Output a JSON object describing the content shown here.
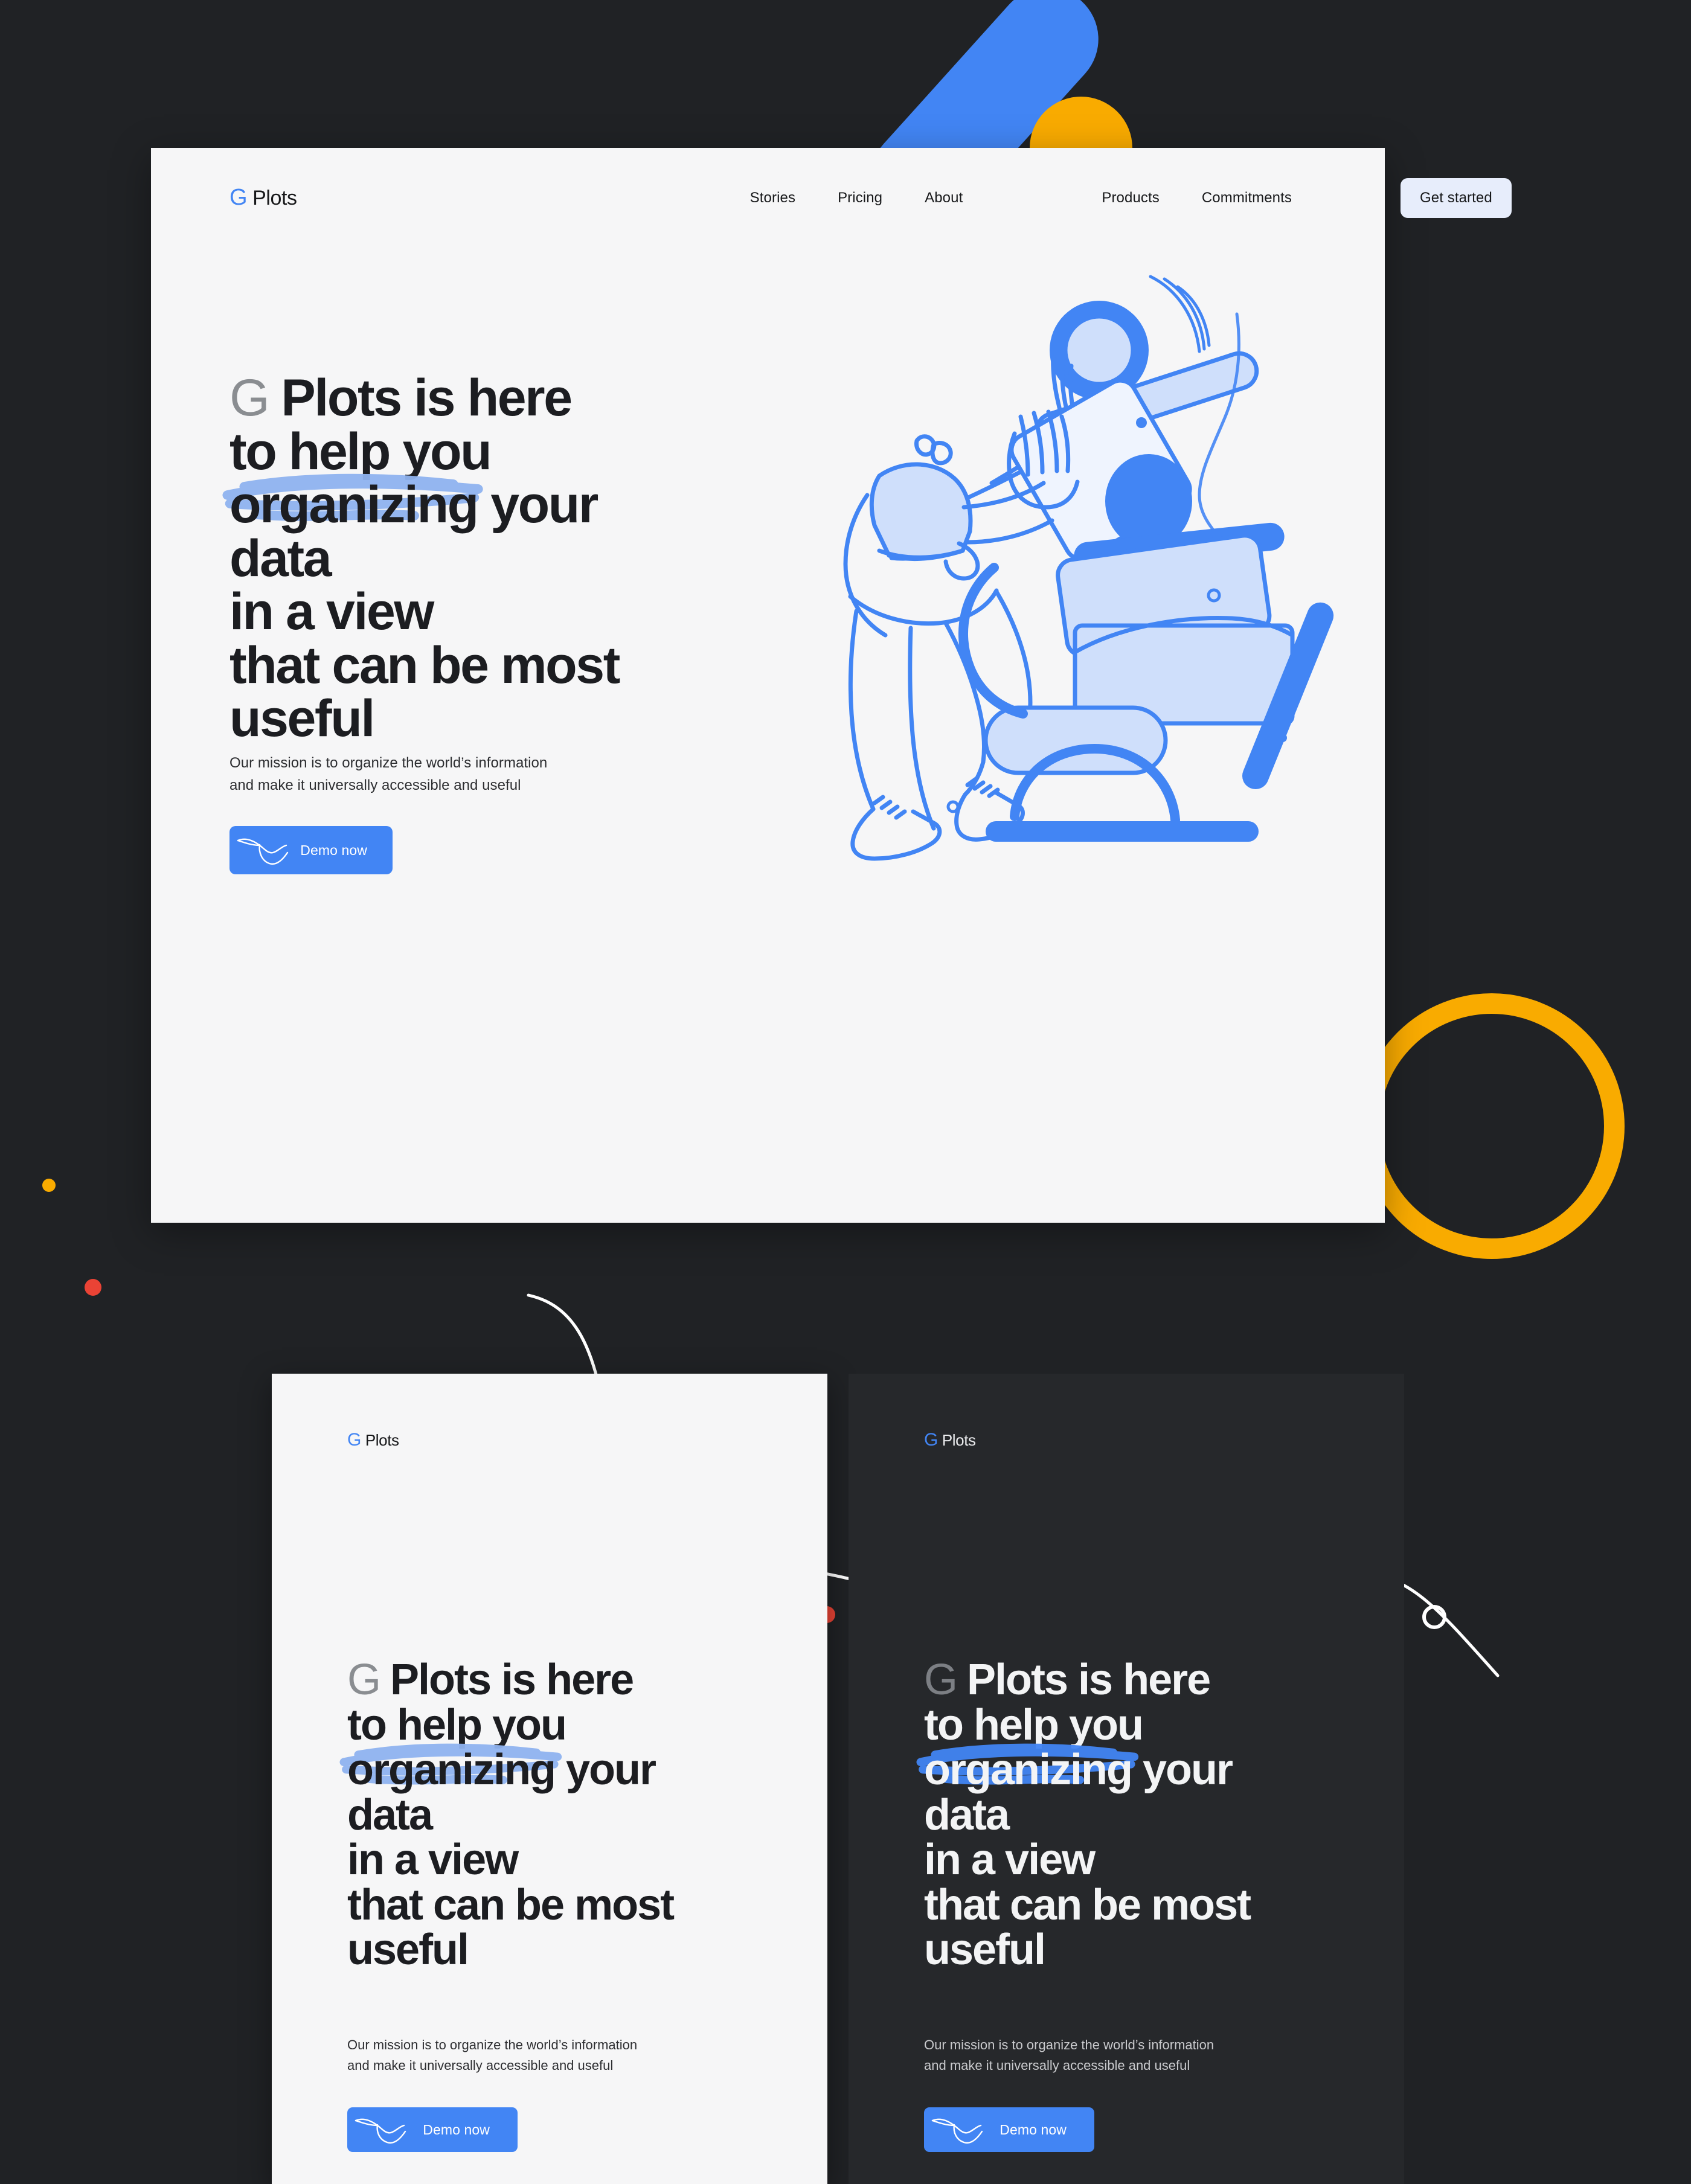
{
  "theme": {
    "page_bg": "#202225",
    "panel_bg": "#F6F6F7",
    "dark_card_bg": "#26282B",
    "brand_blue": "#4285F4",
    "accent_yellow": "#F9AB00",
    "accent_red": "#EA4335",
    "highlight_blue_light": "#8FB3F0",
    "highlight_blue_dark": "#4285F4",
    "text_dark": "#1C1D21",
    "text_light": "#F3F4F5",
    "get_started_bg": "#E7EDFB"
  },
  "brand": {
    "g_letter": "G",
    "name": "Plots"
  },
  "nav": {
    "group_a": [
      {
        "label": "Stories",
        "name": "nav-link-stories"
      },
      {
        "label": "Pricing",
        "name": "nav-link-pricing"
      },
      {
        "label": "About",
        "name": "nav-link-about"
      }
    ],
    "group_b": [
      {
        "label": "Products",
        "name": "nav-link-products"
      },
      {
        "label": "Commitments",
        "name": "nav-link-commitments"
      }
    ],
    "cta": "Get started"
  },
  "hero": {
    "headline": {
      "g_mark": "G",
      "line1_rest": " Plots is here",
      "line2": "to help you",
      "line3_highlight": "organizing",
      "line3_rest": " your",
      "line4": "data",
      "line5": "in a view",
      "line6": "that can be most",
      "line7": "useful"
    },
    "subtitle_line1": "Our mission is to organize the world’s information",
    "subtitle_line2": "and make it universally accessible and useful",
    "demo_button": "Demo now",
    "illustration_name": "person-stacking-blocks-illustration"
  },
  "cards": [
    {
      "id": "light",
      "variant": "light",
      "brand_g": "G",
      "brand_name": "Plots",
      "headline": {
        "g_mark": "G",
        "line1_rest": " Plots is here",
        "line2": "to help you",
        "line3_highlight": "organizing",
        "line3_rest": " your",
        "line4": "data",
        "line5": "in a view",
        "line6": "that can be most",
        "line7": "useful"
      },
      "subtitle_line1": "Our mission is to organize the world’s information",
      "subtitle_line2": "and make it universally accessible and useful",
      "demo_button": "Demo now"
    },
    {
      "id": "dark",
      "variant": "dark",
      "brand_g": "G",
      "brand_name": "Plots",
      "headline": {
        "g_mark": "G",
        "line1_rest": " Plots is here",
        "line2": "to help you",
        "line3_highlight": "organizing",
        "line3_rest": " your",
        "line4": "data",
        "line5": "in a view",
        "line6": "that can be most",
        "line7": "useful"
      },
      "subtitle_line1": "Our mission is to organize the world’s information",
      "subtitle_line2": "and make it universally accessible and useful",
      "demo_button": "Demo now"
    }
  ],
  "decorations": {
    "blue_bar_top": "blue-rounded-bar",
    "yellow_circle_top": "yellow-circle",
    "yellow_ring": "yellow-ring",
    "dot_yellow": "small-yellow-dot",
    "dot_red": "small-red-dot",
    "dot_red_2": "small-red-dot",
    "curves": [
      "white-curve-line",
      "white-curve-line",
      "white-curve-line-with-node"
    ]
  }
}
